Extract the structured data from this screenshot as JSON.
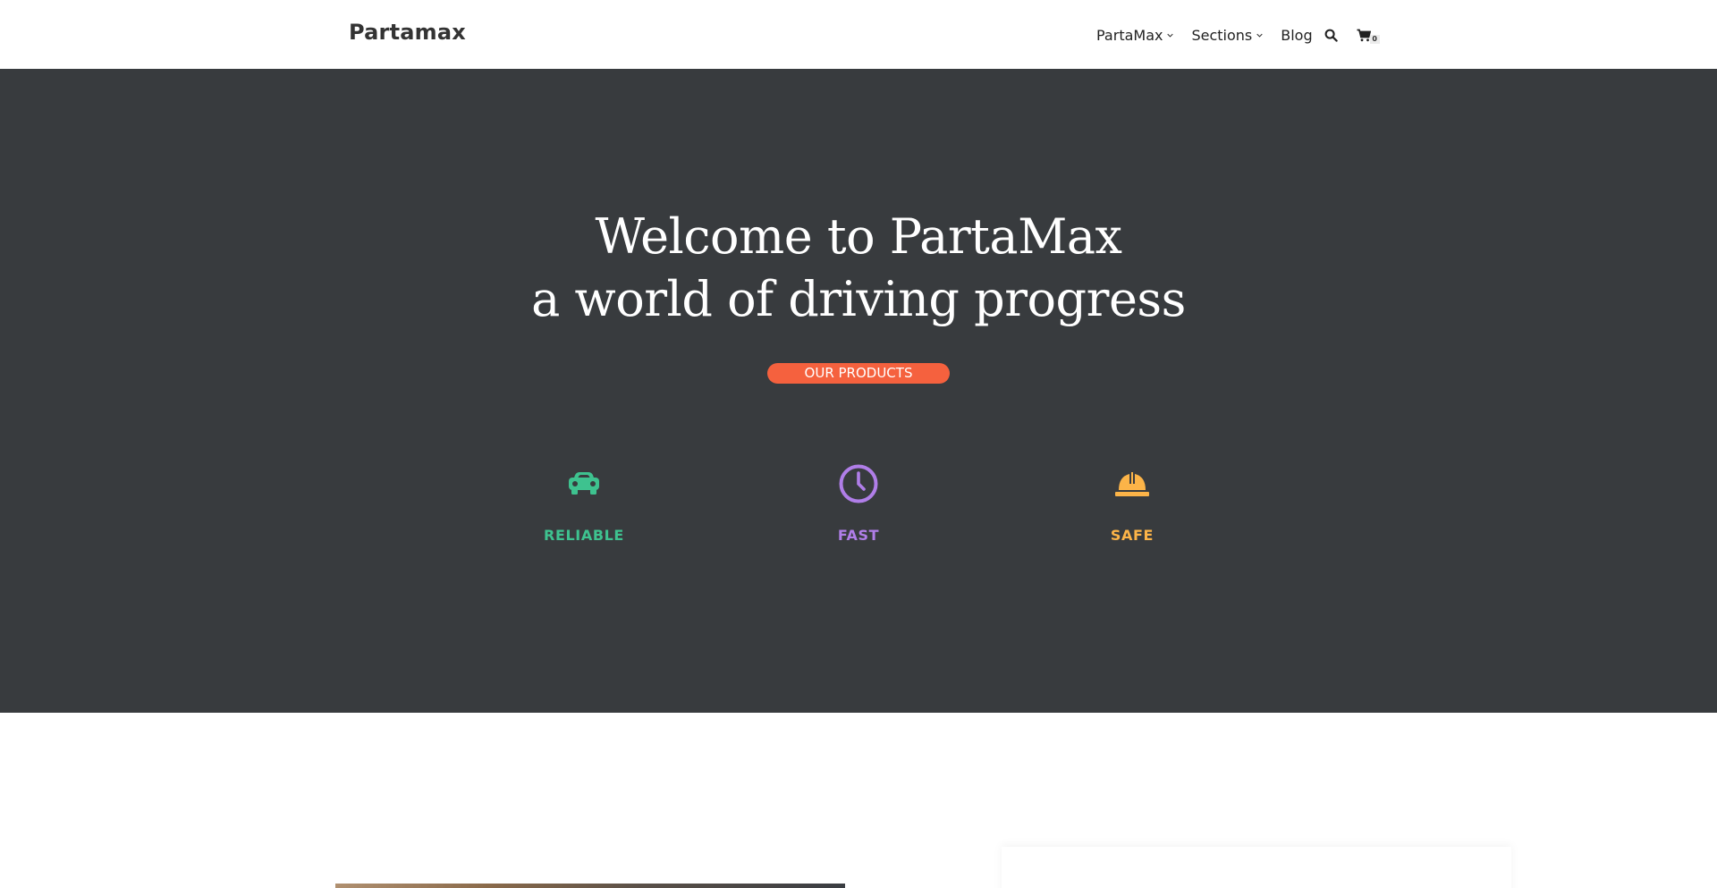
{
  "header": {
    "logo": "Partamax",
    "nav": [
      {
        "label": "PartaMax",
        "has_dropdown": true
      },
      {
        "label": "Sections",
        "has_dropdown": true
      },
      {
        "label": "Blog",
        "has_dropdown": false
      }
    ],
    "search_icon": "search-icon",
    "cart_icon": "cart-icon",
    "cart_count": "0"
  },
  "hero": {
    "title_line1": "Welcome to PartaMax",
    "title_line2": "a world of driving progress",
    "cta_label": "OUR PRODUCTS",
    "features": [
      {
        "label": "RELIABLE",
        "icon": "car-icon",
        "color": "#3ec28f"
      },
      {
        "label": "FAST",
        "icon": "clock-icon",
        "color": "#b07ee8"
      },
      {
        "label": "SAFE",
        "icon": "hard-hat-icon",
        "color": "#fcb448"
      }
    ]
  },
  "colors": {
    "hero_bg": "#383b3e",
    "accent": "#f5613e"
  }
}
